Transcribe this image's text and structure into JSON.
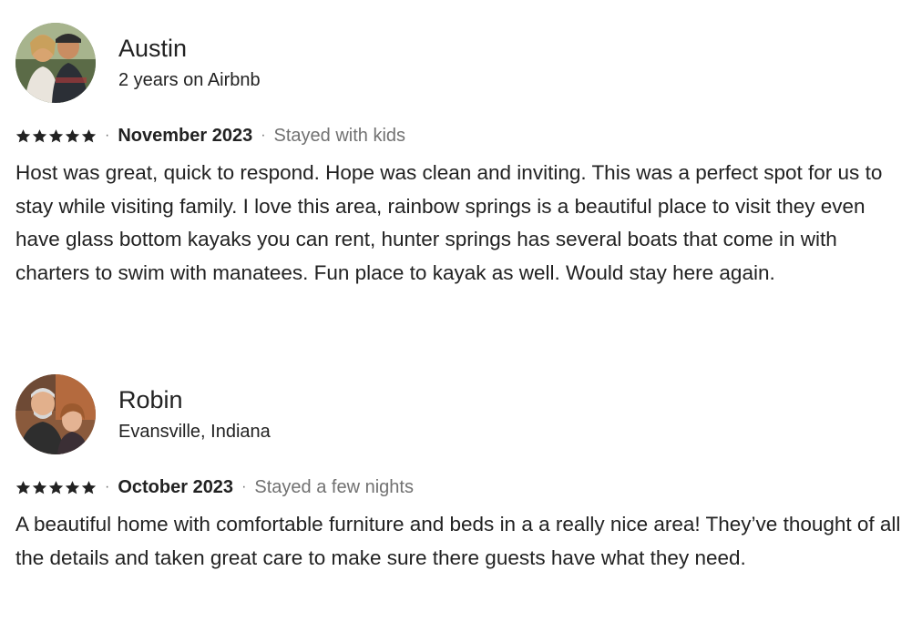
{
  "reviews": [
    {
      "name": "Austin",
      "subtitle": "2 years on Airbnb",
      "rating": 5,
      "date": "November 2023",
      "trip_type": "Stayed with kids",
      "text": "Host was great, quick to respond. Hope was clean and inviting. This was a perfect spot for us to stay while visiting family. I love this area, rainbow springs is a beautiful place to visit they even have glass bottom kayaks you can rent, hunter springs has several boats that come in with charters to swim with manatees. Fun place to kayak as well. Would stay here again."
    },
    {
      "name": "Robin",
      "subtitle": "Evansville, Indiana",
      "rating": 5,
      "date": "October 2023",
      "trip_type": "Stayed a few nights",
      "text": "A beautiful home with comfortable furniture and beds in a a really nice area! They’ve thought of all the details and taken great care to make sure there guests have what they need."
    }
  ],
  "separator": "·",
  "colors": {
    "text_primary": "#222222",
    "text_secondary": "#717171",
    "star": "#222222"
  }
}
